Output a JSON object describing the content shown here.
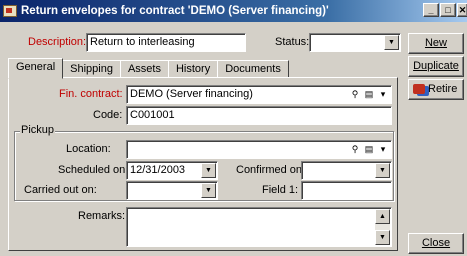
{
  "window": {
    "title": "Return envelopes for contract 'DEMO (Server financing)'",
    "minimize": "_",
    "maximize": "□",
    "close": "✕"
  },
  "header": {
    "description_label": "Description:",
    "description_value": "Return to interleasing",
    "status_label": "Status:",
    "status_value": ""
  },
  "tabs": [
    "General",
    "Shipping",
    "Assets",
    "History",
    "Documents"
  ],
  "general": {
    "fin_contract_label": "Fin. contract:",
    "fin_contract_value": "DEMO (Server financing)",
    "code_label": "Code:",
    "code_value": "C001001"
  },
  "pickup": {
    "group_label": "Pickup",
    "location_label": "Location:",
    "location_value": "",
    "scheduled_label": "Scheduled on:",
    "scheduled_value": "12/31/2003",
    "confirmed_label": "Confirmed on:",
    "confirmed_value": "",
    "carried_label": "Carried out on:",
    "carried_value": "",
    "field1_label": "Field 1:",
    "field1_value": ""
  },
  "remarks": {
    "label": "Remarks:",
    "value": ""
  },
  "actions": {
    "new": "New",
    "duplicate": "Duplicate",
    "retire": "Retire",
    "close": "Close"
  }
}
